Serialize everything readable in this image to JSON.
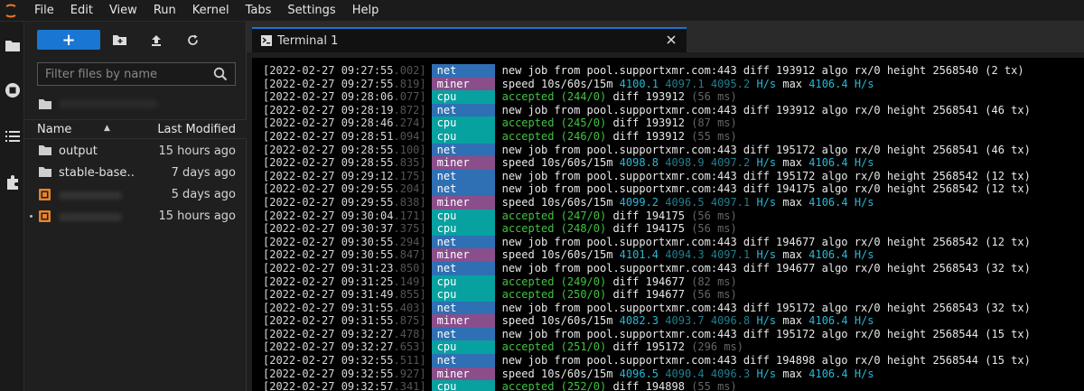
{
  "menu": [
    "File",
    "Edit",
    "View",
    "Run",
    "Kernel",
    "Tabs",
    "Settings",
    "Help"
  ],
  "toolbar": {
    "new_label": "+"
  },
  "filter": {
    "placeholder": "Filter files by name"
  },
  "header": {
    "name": "Name",
    "modified": "Last Modified"
  },
  "files": [
    {
      "name": "output",
      "modified": "15 hours ago",
      "icon": "folder-icon"
    },
    {
      "name": "stable-base…",
      "modified": "7 days ago",
      "icon": "folder-icon"
    },
    {
      "name": "",
      "modified": "5 days ago",
      "icon": "notebook-icon"
    },
    {
      "name": "",
      "modified": "15 hours ago",
      "icon": "notebook-icon"
    }
  ],
  "tab": {
    "label": "Terminal 1"
  },
  "log": [
    {
      "date": "[2022-02-27 09:27:55",
      "ms": ".002]",
      "tag": "net",
      "msg": "new job from pool.supportxmr.com:443 diff 193912 algo rx/0 height 2568540 (2 tx)"
    },
    {
      "date": "[2022-02-27 09:27:55",
      "ms": ".819]",
      "tag": "miner",
      "s1": "4100.1",
      "s2": "4097.1",
      "s3": "4095.2",
      "max": "4106.4"
    },
    {
      "date": "[2022-02-27 09:28:06",
      "ms": ".077]",
      "tag": "cpu",
      "acc": "(244/0)",
      "diff": "193912",
      "took": "(56 ms)"
    },
    {
      "date": "[2022-02-27 09:28:19",
      "ms": ".872]",
      "tag": "net",
      "msg": "new job from pool.supportxmr.com:443 diff 193912 algo rx/0 height 2568541 (46 tx)"
    },
    {
      "date": "[2022-02-27 09:28:46",
      "ms": ".274]",
      "tag": "cpu",
      "acc": "(245/0)",
      "diff": "193912",
      "took": "(87 ms)"
    },
    {
      "date": "[2022-02-27 09:28:51",
      "ms": ".094]",
      "tag": "cpu",
      "acc": "(246/0)",
      "diff": "193912",
      "took": "(55 ms)"
    },
    {
      "date": "[2022-02-27 09:28:55",
      "ms": ".100]",
      "tag": "net",
      "msg": "new job from pool.supportxmr.com:443 diff 195172 algo rx/0 height 2568541 (46 tx)"
    },
    {
      "date": "[2022-02-27 09:28:55",
      "ms": ".835]",
      "tag": "miner",
      "s1": "4098.8",
      "s2": "4098.9",
      "s3": "4097.2",
      "max": "4106.4"
    },
    {
      "date": "[2022-02-27 09:29:12",
      "ms": ".175]",
      "tag": "net",
      "msg": "new job from pool.supportxmr.com:443 diff 195172 algo rx/0 height 2568542 (12 tx)"
    },
    {
      "date": "[2022-02-27 09:29:55",
      "ms": ".204]",
      "tag": "net",
      "msg": "new job from pool.supportxmr.com:443 diff 194175 algo rx/0 height 2568542 (12 tx)"
    },
    {
      "date": "[2022-02-27 09:29:55",
      "ms": ".838]",
      "tag": "miner",
      "s1": "4099.2",
      "s2": "4096.5",
      "s3": "4097.1",
      "max": "4106.4"
    },
    {
      "date": "[2022-02-27 09:30:04",
      "ms": ".171]",
      "tag": "cpu",
      "acc": "(247/0)",
      "diff": "194175",
      "took": "(56 ms)"
    },
    {
      "date": "[2022-02-27 09:30:37",
      "ms": ".375]",
      "tag": "cpu",
      "acc": "(248/0)",
      "diff": "194175",
      "took": "(56 ms)"
    },
    {
      "date": "[2022-02-27 09:30:55",
      "ms": ".294]",
      "tag": "net",
      "msg": "new job from pool.supportxmr.com:443 diff 194677 algo rx/0 height 2568542 (12 tx)"
    },
    {
      "date": "[2022-02-27 09:30:55",
      "ms": ".847]",
      "tag": "miner",
      "s1": "4101.4",
      "s2": "4094.3",
      "s3": "4097.1",
      "max": "4106.4"
    },
    {
      "date": "[2022-02-27 09:31:23",
      "ms": ".850]",
      "tag": "net",
      "msg": "new job from pool.supportxmr.com:443 diff 194677 algo rx/0 height 2568543 (32 tx)"
    },
    {
      "date": "[2022-02-27 09:31:25",
      "ms": ".149]",
      "tag": "cpu",
      "acc": "(249/0)",
      "diff": "194677",
      "took": "(82 ms)"
    },
    {
      "date": "[2022-02-27 09:31:49",
      "ms": ".855]",
      "tag": "cpu",
      "acc": "(250/0)",
      "diff": "194677",
      "took": "(56 ms)"
    },
    {
      "date": "[2022-02-27 09:31:55",
      "ms": ".403]",
      "tag": "net",
      "msg": "new job from pool.supportxmr.com:443 diff 195172 algo rx/0 height 2568543 (32 tx)"
    },
    {
      "date": "[2022-02-27 09:31:55",
      "ms": ".875]",
      "tag": "miner",
      "s1": "4082.3",
      "s2": "4093.7",
      "s3": "4096.8",
      "max": "4106.4"
    },
    {
      "date": "[2022-02-27 09:32:27",
      "ms": ".478]",
      "tag": "net",
      "msg": "new job from pool.supportxmr.com:443 diff 195172 algo rx/0 height 2568544 (15 tx)"
    },
    {
      "date": "[2022-02-27 09:32:27",
      "ms": ".653]",
      "tag": "cpu",
      "acc": "(251/0)",
      "diff": "195172",
      "took": "(296 ms)"
    },
    {
      "date": "[2022-02-27 09:32:55",
      "ms": ".511]",
      "tag": "net",
      "msg": "new job from pool.supportxmr.com:443 diff 194898 algo rx/0 height 2568544 (15 tx)"
    },
    {
      "date": "[2022-02-27 09:32:55",
      "ms": ".927]",
      "tag": "miner",
      "s1": "4096.5",
      "s2": "4090.4",
      "s3": "4096.3",
      "max": "4106.4"
    },
    {
      "date": "[2022-02-27 09:32:57",
      "ms": ".341]",
      "tag": "cpu",
      "acc": "(252/0)",
      "diff": "194898",
      "took": "(55 ms)"
    }
  ],
  "colors": {
    "accent": "#1976d2",
    "net": "#2f6fb3",
    "miner": "#8a4e8a",
    "cpu": "#07a19f"
  }
}
